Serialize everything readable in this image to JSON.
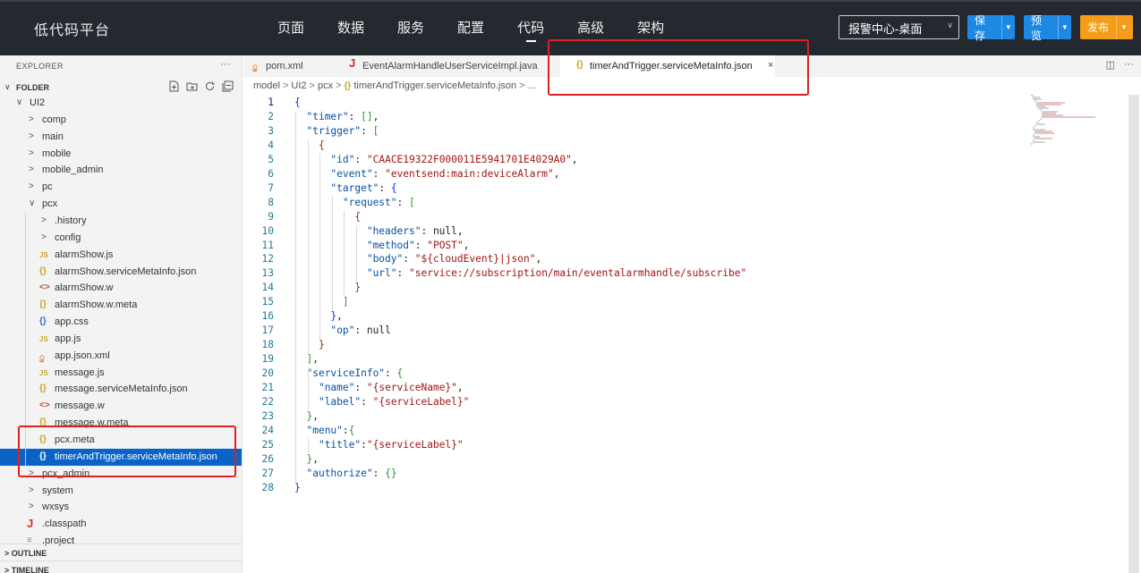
{
  "app": {
    "title": "低代码平台"
  },
  "menu": [
    {
      "label": "页面"
    },
    {
      "label": "数据"
    },
    {
      "label": "服务"
    },
    {
      "label": "配置"
    },
    {
      "label": "代码",
      "active": true
    },
    {
      "label": "高级"
    },
    {
      "label": "架构"
    }
  ],
  "environment": {
    "selected": "报警中心-桌面"
  },
  "actions": {
    "save": "保存",
    "preview": "预览",
    "publish": "发布"
  },
  "colors": {
    "topbar": "#23292f",
    "primary": "#1e88e5",
    "publish": "#f59c1a",
    "highlight": "#e02020",
    "selection": "#0a64c8"
  },
  "explorer": {
    "header": "EXPLORER",
    "more": "···",
    "folder": "FOLDER",
    "folder_actions": [
      "new-file-icon",
      "new-folder-icon",
      "refresh-icon",
      "collapse-all-icon"
    ],
    "tree": [
      {
        "name": "UI2",
        "kind": "folder",
        "expanded": true,
        "depth": 0
      },
      {
        "name": "comp",
        "kind": "folder",
        "expanded": false,
        "depth": 1
      },
      {
        "name": "main",
        "kind": "folder",
        "expanded": false,
        "depth": 1
      },
      {
        "name": "mobile",
        "kind": "folder",
        "expanded": false,
        "depth": 1
      },
      {
        "name": "mobile_admin",
        "kind": "folder",
        "expanded": false,
        "depth": 1
      },
      {
        "name": "pc",
        "kind": "folder",
        "expanded": false,
        "depth": 1
      },
      {
        "name": "pcx",
        "kind": "folder",
        "expanded": true,
        "depth": 1
      },
      {
        "name": ".history",
        "kind": "folder",
        "expanded": false,
        "depth": 2
      },
      {
        "name": "config",
        "kind": "folder",
        "expanded": false,
        "depth": 2
      },
      {
        "name": "alarmShow.js",
        "kind": "file",
        "icon": "JS",
        "icon_class": "ic-js",
        "depth": 2
      },
      {
        "name": "alarmShow.serviceMetaInfo.json",
        "kind": "file",
        "icon": "{}",
        "icon_class": "ic-json",
        "depth": 2
      },
      {
        "name": "alarmShow.w",
        "kind": "file",
        "icon": "<>",
        "icon_class": "ic-w",
        "depth": 2
      },
      {
        "name": "alarmShow.w.meta",
        "kind": "file",
        "icon": "{}",
        "icon_class": "ic-json",
        "depth": 2
      },
      {
        "name": "app.css",
        "kind": "file",
        "icon": "{}",
        "icon_class": "ic-css",
        "depth": 2
      },
      {
        "name": "app.js",
        "kind": "file",
        "icon": "JS",
        "icon_class": "ic-js",
        "depth": 2
      },
      {
        "name": "app.json.xml",
        "kind": "file",
        "icon": "ु",
        "icon_class": "ic-xml",
        "depth": 2
      },
      {
        "name": "message.js",
        "kind": "file",
        "icon": "JS",
        "icon_class": "ic-js",
        "depth": 2
      },
      {
        "name": "message.serviceMetaInfo.json",
        "kind": "file",
        "icon": "{}",
        "icon_class": "ic-json",
        "depth": 2
      },
      {
        "name": "message.w",
        "kind": "file",
        "icon": "<>",
        "icon_class": "ic-w",
        "depth": 2
      },
      {
        "name": "message.w.meta",
        "kind": "file",
        "icon": "{}",
        "icon_class": "ic-json",
        "depth": 2
      },
      {
        "name": "pcx.meta",
        "kind": "file",
        "icon": "{}",
        "icon_class": "ic-json",
        "depth": 2
      },
      {
        "name": "timerAndTrigger.serviceMetaInfo.json",
        "kind": "file",
        "icon": "{}",
        "icon_class": "ic-json",
        "depth": 2,
        "selected": true
      },
      {
        "name": "pcx_admin",
        "kind": "folder",
        "expanded": false,
        "depth": 1
      },
      {
        "name": "system",
        "kind": "folder",
        "expanded": false,
        "depth": 1
      },
      {
        "name": "wxsys",
        "kind": "folder",
        "expanded": false,
        "depth": 1
      },
      {
        "name": ".classpath",
        "kind": "file",
        "icon": "J",
        "icon_class": "ic-j",
        "depth": 1
      },
      {
        "name": ".project",
        "kind": "file",
        "icon": "≡",
        "icon_class": "ic-lines",
        "depth": 1
      }
    ],
    "footer": [
      {
        "label": "OUTLINE"
      },
      {
        "label": "TIMELINE"
      }
    ]
  },
  "tabs": [
    {
      "label": "pom.xml",
      "icon": "ु",
      "icon_class": "ic-xml"
    },
    {
      "label": "EventAlarmHandleUserServiceImpl.java",
      "icon": "J",
      "icon_class": "ic-j"
    },
    {
      "label": "timerAndTrigger.serviceMetaInfo.json",
      "icon": "{}",
      "icon_class": "ic-json",
      "active": true
    }
  ],
  "tab_close": "×",
  "tab_tools": {
    "split": "◫",
    "more": "···"
  },
  "breadcrumb": [
    "model",
    "UI2",
    "pcx",
    "timerAndTrigger.serviceMetaInfo.json",
    "..."
  ],
  "editor": {
    "current_line": 1,
    "lines": [
      "{",
      "  \"timer\": [],",
      "  \"trigger\": [",
      "    {",
      "      \"id\": \"CAACE19322F000011E5941701E4029A0\",",
      "      \"event\": \"eventsend:main:deviceAlarm\",",
      "      \"target\": {",
      "        \"request\": [",
      "          {",
      "            \"headers\": null,",
      "            \"method\": \"POST\",",
      "            \"body\": \"${cloudEvent}|json\",",
      "            \"url\": \"service://subscription/main/eventalarmhandle/subscribe\"",
      "          }",
      "        ]",
      "      },",
      "      \"op\": null",
      "    }",
      "  ],",
      "  \"serviceInfo\": {",
      "    \"name\": \"{serviceName}\",",
      "    \"label\": \"{serviceLabel}\"",
      "  },",
      "  \"menu\":{",
      "    \"title\":\"{serviceLabel}\"",
      "  },",
      "  \"authorize\": {}",
      "}"
    ]
  }
}
